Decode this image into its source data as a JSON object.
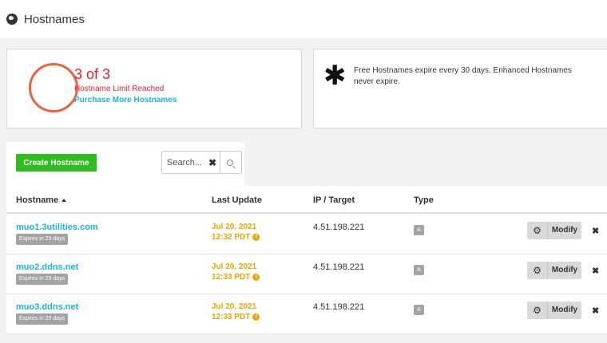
{
  "header": {
    "title": "Hostnames",
    "icon": "globe-icon"
  },
  "limit_card": {
    "count_text": "3 of 3",
    "status_text": "Hostname Limit Reached",
    "purchase_link": "Purchase More Hostnames",
    "ring_color": "#f0603e"
  },
  "info_card": {
    "icon": "asterisk-icon",
    "text": "Free Hostnames expire every 30 days. Enhanced Hostnames never expire."
  },
  "toolbar": {
    "create_label": "Create Hostname",
    "search_placeholder": "Search...",
    "clear_label": "✖"
  },
  "table": {
    "columns": {
      "hostname": "Hostname",
      "last_update": "Last Update",
      "ip_target": "IP / Target",
      "type": "Type"
    },
    "rows": [
      {
        "hostname": "muo1.3utilities.com",
        "expires": "Expires in 29 days",
        "date": "Jul 20, 2021",
        "time": "12:32 PDT",
        "ip": "4.51.198.221",
        "type": "A",
        "modify": "Modify"
      },
      {
        "hostname": "muo2.ddns.net",
        "expires": "Expires in 29 days",
        "date": "Jul 20, 2021",
        "time": "12:33 PDT",
        "ip": "4.51.198.221",
        "type": "A",
        "modify": "Modify"
      },
      {
        "hostname": "muo3.ddns.net",
        "expires": "Expires in 29 days",
        "date": "Jul 20, 2021",
        "time": "12:33 PDT",
        "ip": "4.51.198.221",
        "type": "A",
        "modify": "Modify"
      }
    ]
  },
  "colors": {
    "accent_cyan": "#19b6d8",
    "warning_orange": "#f0a400",
    "limit_red": "#e8202d",
    "create_green": "#2ebd1e"
  }
}
